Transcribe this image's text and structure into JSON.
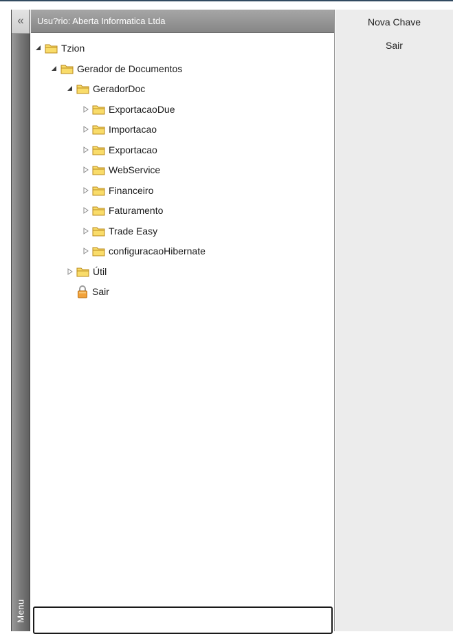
{
  "sidebar": {
    "collapse_glyph": "«",
    "vertical_label": "Menu"
  },
  "panel": {
    "header_text": "Usu?rio: Aberta Informatica Ltda"
  },
  "tree": {
    "root": {
      "label": "Tzion",
      "expanded": true
    },
    "gerador": {
      "label": "Gerador de Documentos",
      "expanded": true
    },
    "geradordoc": {
      "label": "GeradorDoc",
      "expanded": true
    },
    "children": [
      {
        "label": "ExportacaoDue",
        "expanded": false
      },
      {
        "label": "Importacao",
        "expanded": false
      },
      {
        "label": "Exportacao",
        "expanded": false
      },
      {
        "label": "WebService",
        "expanded": false
      },
      {
        "label": "Financeiro",
        "expanded": false
      },
      {
        "label": "Faturamento",
        "expanded": false
      },
      {
        "label": "Trade Easy",
        "expanded": false
      },
      {
        "label": "configuracaoHibernate",
        "expanded": false
      }
    ],
    "util": {
      "label": "Útil",
      "expanded": false
    },
    "sair": {
      "label": "Sair",
      "icon": "lock-icon"
    }
  },
  "right_panel": {
    "nova_chave_label": "Nova Chave",
    "sair_label": "Sair"
  },
  "colors": {
    "folder_fill": "#f9dc6a",
    "folder_stroke": "#b98a1c",
    "header_bg": "#969696",
    "right_bg": "#ececec"
  }
}
